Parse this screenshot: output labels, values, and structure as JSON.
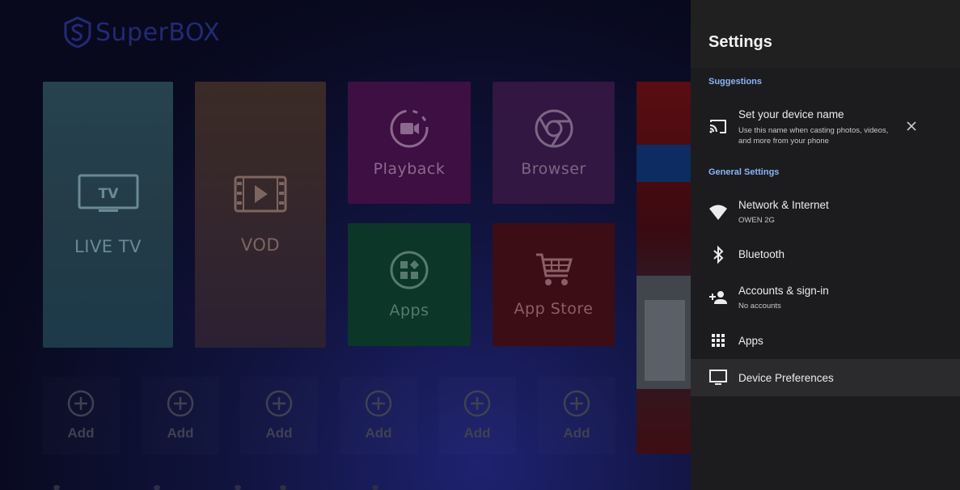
{
  "launcher": {
    "brand": "SuperBOX",
    "tiles": {
      "live_tv": "LIVE TV",
      "vod": "VOD",
      "playback": "Playback",
      "browser": "Browser",
      "apps": "Apps",
      "app_store": "App Store"
    },
    "add_slots": [
      "Add",
      "Add",
      "Add",
      "Add",
      "Add",
      "Add"
    ],
    "tv_badge": "TV"
  },
  "settings": {
    "title": "Settings",
    "suggestions_label": "Suggestions",
    "suggestion": {
      "title": "Set your device name",
      "subtitle_line1": "Use this name when casting photos, videos,",
      "subtitle_line2": "and more from your phone"
    },
    "general_label": "General Settings",
    "items": [
      {
        "title": "Network & Internet",
        "subtitle": "OWEN 2G",
        "icon": "wifi-icon"
      },
      {
        "title": "Bluetooth",
        "subtitle": "",
        "icon": "bluetooth-icon"
      },
      {
        "title": "Accounts & sign-in",
        "subtitle": "No accounts",
        "icon": "add-person-icon"
      },
      {
        "title": "Apps",
        "subtitle": "",
        "icon": "apps-grid-icon"
      },
      {
        "title": "Device Preferences",
        "subtitle": "",
        "icon": "monitor-icon"
      }
    ],
    "colors": {
      "panel_bg": "#1c1c1e",
      "section_label": "#8ab4f8",
      "highlight_row": "#2b2b2d"
    }
  }
}
